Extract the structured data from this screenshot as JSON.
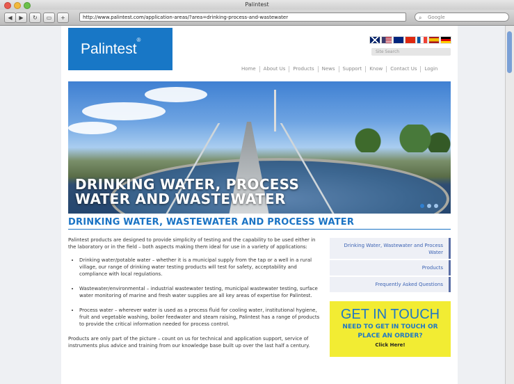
{
  "browser": {
    "title": "Palintest",
    "url": "http://www.palintest.com/application-areas/?area=drinking-process-and-wastewater",
    "search_placeholder": "Google"
  },
  "site": {
    "logo": "Palintest",
    "logo_mark": "®",
    "search_placeholder": "Site Search",
    "flags": [
      "uk-flag",
      "us-flag",
      "au-flag",
      "cn-flag",
      "fr-flag",
      "es-flag",
      "de-flag"
    ],
    "nav": [
      "Home",
      "About Us",
      "Products",
      "News",
      "Support",
      "Know",
      "Contact Us",
      "Login"
    ]
  },
  "hero": {
    "title_line1": "DRINKING WATER, PROCESS",
    "title_line2": "WATER AND WASTEWATER"
  },
  "main": {
    "heading": "DRINKING WATER, WASTEWATER AND PROCESS WATER",
    "intro": "Palintest products are designed to provide simplicity of testing and the capability to be used either in the laboratory or in the field – both aspects making them ideal for use in a variety of applications:",
    "bullets": [
      "Drinking water/potable water – whether it is a municipal supply from the tap or a well in a rural village, our range of drinking water testing products will test for safety, acceptability and compliance with local regulations.",
      "Wastewater/environmental – industrial wastewater testing, municipal wastewater testing, surface water monitoring of marine and fresh water supplies are all key areas of expertise for Palintest.",
      "Process water – wherever water is used as a process fluid for cooling water, institutional hygiene, fruit and vegetable washing, boiler feedwater and steam raising, Palintest has a range of products to provide the critical information needed for process control."
    ],
    "outro": "Products are only part of the picture – count on us for technical and application support, service of instruments plus advice and training from our knowledge base built up over the last half a century."
  },
  "sidebar": {
    "items": [
      "Drinking Water, Wastewater and Process Water",
      "Products",
      "Frequently Asked Questions"
    ]
  },
  "cta": {
    "title": "GET IN TOUCH",
    "line1": "NEED TO GET IN TOUCH OR",
    "line2": "PLACE AN ORDER?",
    "click": "Click Here!"
  },
  "colors": {
    "brand": "#1877c6",
    "cta_bg": "#f2ec33",
    "link": "#3b62b3"
  }
}
